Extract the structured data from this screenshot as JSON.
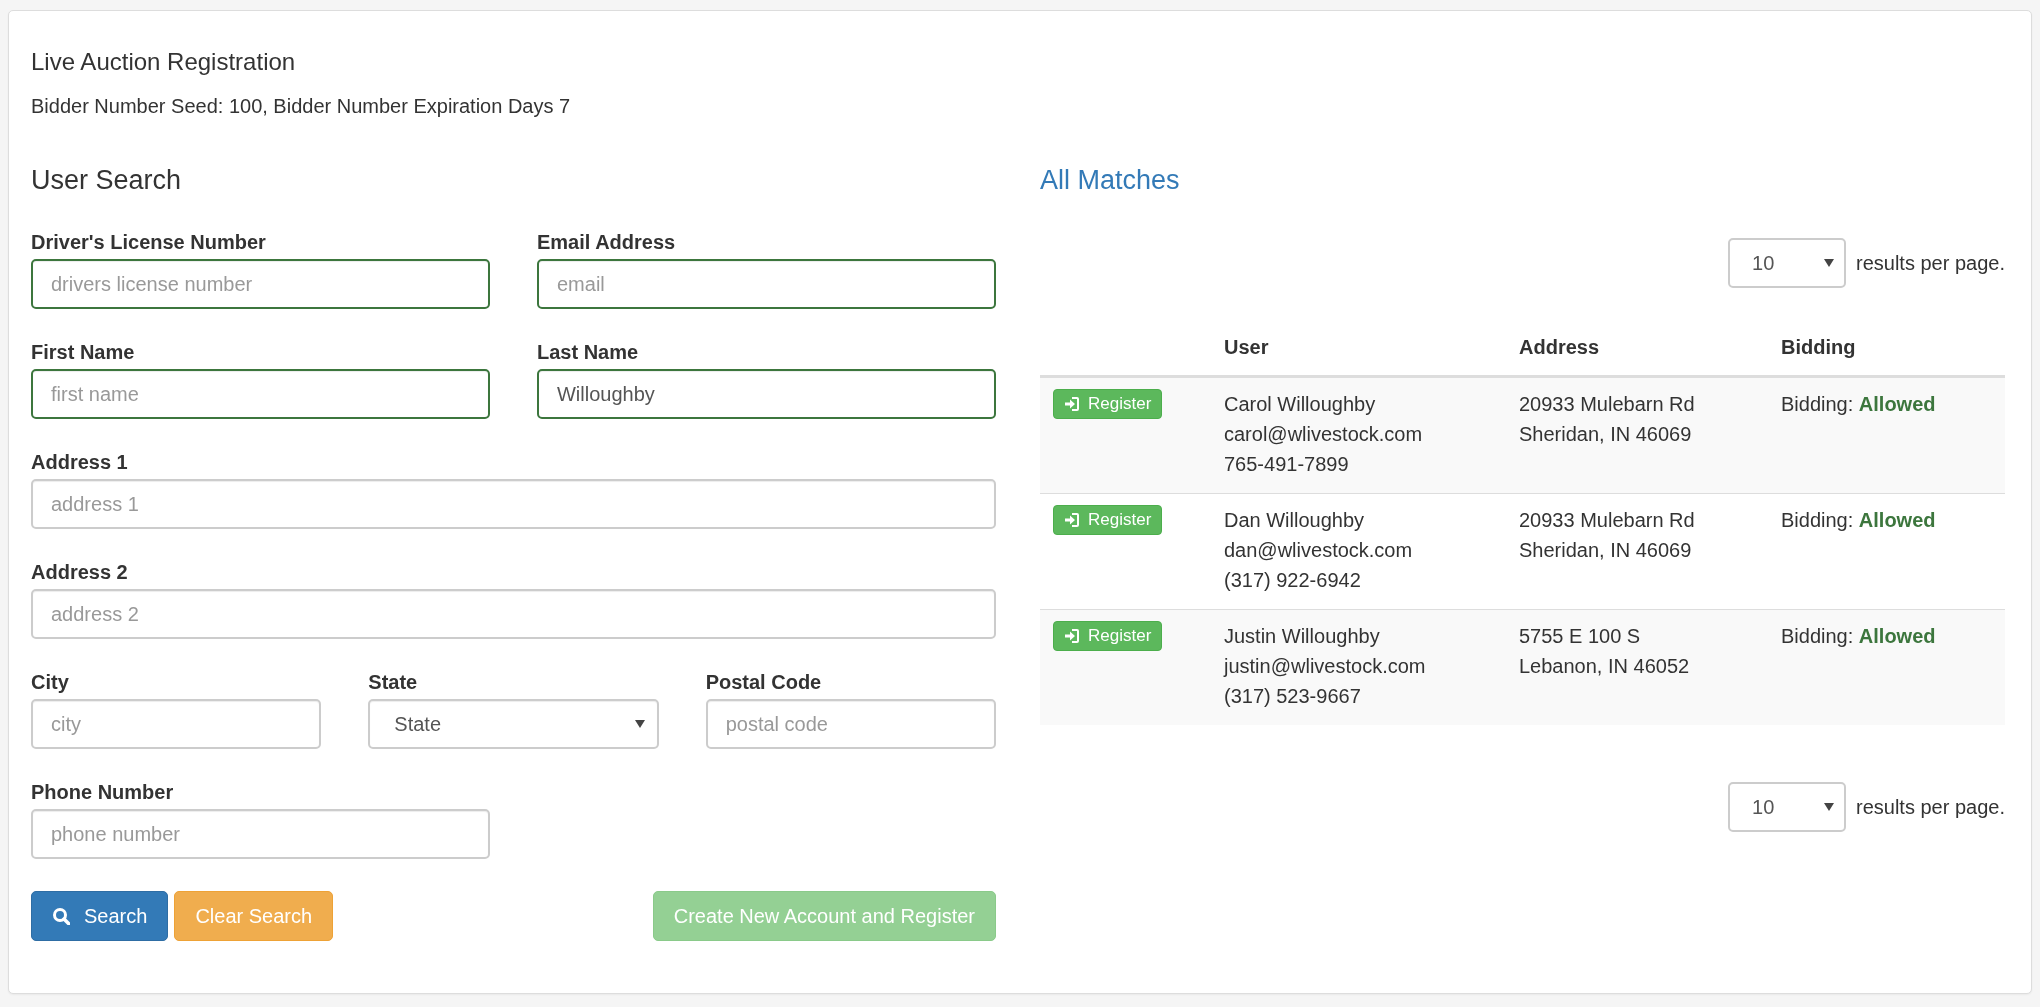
{
  "page": {
    "title": "Live Auction Registration",
    "subtitle": "Bidder Number Seed: 100, Bidder Number Expiration Days 7"
  },
  "search": {
    "title": "User Search",
    "fields": [
      {
        "kind": "text",
        "label": "Driver's License Number",
        "placeholder": "drivers license number",
        "valid": true
      },
      {
        "kind": "text",
        "label": "Email Address",
        "placeholder": "email",
        "valid": true
      },
      {
        "kind": "text",
        "label": "First Name",
        "placeholder": "first name",
        "valid": true
      },
      {
        "kind": "text",
        "label": "Last Name",
        "value": "Willoughby",
        "valid": true
      },
      {
        "kind": "text",
        "label": "Address 1",
        "placeholder": "address 1",
        "valid": false
      },
      {
        "kind": "text",
        "label": "Address 2",
        "placeholder": "address 2",
        "valid": false
      },
      {
        "kind": "text",
        "label": "City",
        "placeholder": "city",
        "valid": false
      },
      {
        "kind": "select",
        "label": "State",
        "value": "State",
        "valid": false
      },
      {
        "kind": "text",
        "label": "Postal Code",
        "placeholder": "postal code",
        "valid": false
      },
      {
        "kind": "text",
        "label": "Phone Number",
        "placeholder": "phone number",
        "valid": false
      }
    ],
    "buttons": [
      {
        "kind": "primary",
        "label": "Search",
        "disabled": false
      },
      {
        "kind": "warning",
        "label": "Clear Search",
        "disabled": false
      },
      {
        "kind": "success",
        "label": "Create New Account and Register",
        "disabled": true
      }
    ]
  },
  "matches": {
    "title": "All Matches",
    "page_size_top": {
      "value": "10",
      "suffix": "results per page."
    },
    "columns": [
      "User",
      "Address",
      "Bidding"
    ],
    "rows": [
      {
        "action": "Register",
        "user": [
          "Carol Willoughby",
          "carol@wlivestock.com",
          "765-491-7899"
        ],
        "address": [
          "20933 Mulebarn Rd",
          "Sheridan, IN 46069"
        ],
        "bidding": "Bidding:",
        "status": "Allowed"
      },
      {
        "action": "Register",
        "user": [
          "Dan Willoughby",
          "dan@wlivestock.com",
          "(317) 922-6942"
        ],
        "address": [
          "20933 Mulebarn Rd",
          "Sheridan, IN 46069"
        ],
        "bidding": "Bidding:",
        "status": "Allowed"
      },
      {
        "action": "Register",
        "user": [
          "Justin Willoughby",
          "justin@wlivestock.com",
          "(317) 523-9667"
        ],
        "address": [
          "5755 E 100 S",
          "Lebanon, IN 46052"
        ],
        "bidding": "Bidding:",
        "status": "Allowed"
      }
    ],
    "page_size_bottom": {
      "value": "10",
      "suffix": "results per page."
    }
  }
}
